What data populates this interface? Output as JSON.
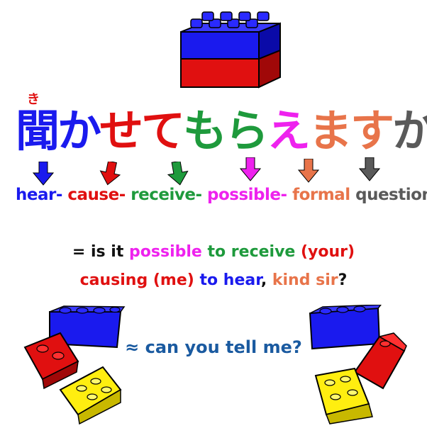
{
  "colors": {
    "blue": "#1a1aee",
    "red": "#e01010",
    "green": "#1e9a3c",
    "magenta": "#ee22ee",
    "orange": "#e8744a",
    "gray": "#5a5a5a",
    "dark_blue": "#1a5aa0",
    "black": "#111111"
  },
  "furigana": "き",
  "japanese": [
    {
      "char": "聞",
      "color": "blue"
    },
    {
      "char": "か",
      "color": "blue"
    },
    {
      "char": "せ",
      "color": "red"
    },
    {
      "char": "て",
      "color": "red"
    },
    {
      "char": "も",
      "color": "green"
    },
    {
      "char": "ら",
      "color": "green"
    },
    {
      "char": "え",
      "color": "magenta"
    },
    {
      "char": "ま",
      "color": "orange"
    },
    {
      "char": "す",
      "color": "orange"
    },
    {
      "char": "か",
      "color": "gray"
    }
  ],
  "gloss": [
    {
      "text": "hear-",
      "color": "blue"
    },
    {
      "text": "cause-",
      "color": "red"
    },
    {
      "text": "receive-",
      "color": "green"
    },
    {
      "text": "possible-",
      "color": "magenta"
    },
    {
      "text": "formal",
      "color": "orange"
    },
    {
      "text": "question",
      "color": "gray"
    }
  ],
  "translation_line1": [
    {
      "text": "= is it ",
      "color": "black"
    },
    {
      "text": "possible",
      "color": "magenta"
    },
    {
      "text": " to receive",
      "color": "green"
    },
    {
      "text": " (your)",
      "color": "red"
    }
  ],
  "translation_line2": [
    {
      "text": "causing (me)",
      "color": "red"
    },
    {
      "text": " to hear",
      "color": "blue"
    },
    {
      "text": ", ",
      "color": "black"
    },
    {
      "text": "kind sir",
      "color": "orange"
    },
    {
      "text": "?",
      "color": "black"
    }
  ],
  "approx_line": "≈ can you tell me?",
  "icons": [
    "lego-brick-stack-icon",
    "lego-brick-pile-left-icon",
    "lego-brick-pile-right-icon",
    "arrow-down-icon"
  ]
}
